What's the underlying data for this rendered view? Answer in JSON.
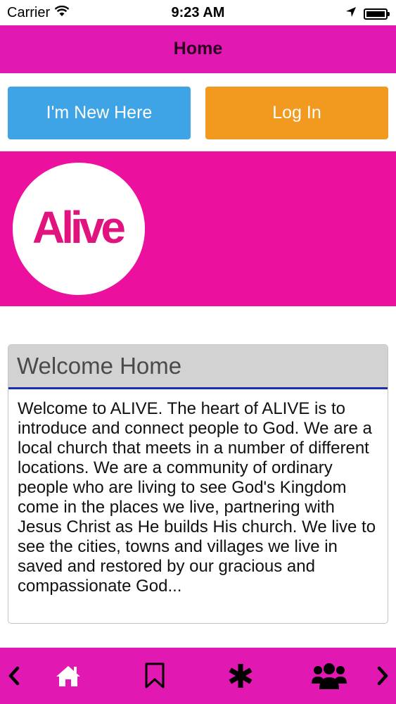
{
  "status_bar": {
    "carrier": "Carrier",
    "time": "9:23 AM",
    "battery_level": 1.0
  },
  "header": {
    "title": "Home"
  },
  "actions": {
    "new_here_label": "I'm New Here",
    "login_label": "Log In"
  },
  "banner": {
    "logo_text": "Alive"
  },
  "welcome": {
    "title": "Welcome Home",
    "body": "Welcome to ALIVE. The heart of ALIVE is to introduce and connect people to God. We are a local church that meets in a number of different locations. We are a community of ordinary people who are living to see God's Kingdom come in the places we live, partnering with Jesus Christ as He builds His church. We live to see the cities, towns and villages we live in saved and restored by our gracious and compassionate God..."
  },
  "tab_bar": {
    "icons": [
      "chevron-left-icon",
      "home-icon",
      "bookmark-icon",
      "asterisk-icon",
      "group-icon",
      "chevron-right-icon"
    ]
  },
  "colors": {
    "title_bar": "#e118b1",
    "banner": "#ec109f",
    "button_new": "#3fa4e6",
    "button_login": "#f29a20",
    "header_underline": "#1a2fb0"
  }
}
